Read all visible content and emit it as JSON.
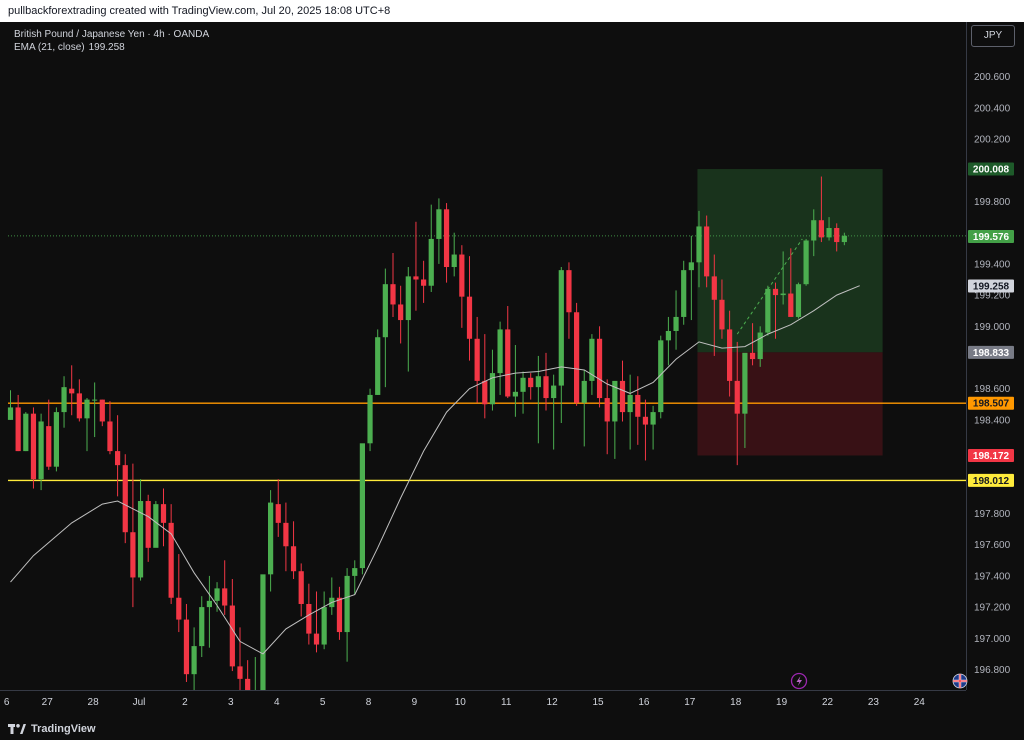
{
  "header": {
    "credit": "pullbackforextrading created with TradingView.com, Jul 20, 2025 18:08 UTC+8"
  },
  "legend": {
    "symbol_line": "British Pound / Japanese Yen · 4h · OANDA",
    "ema_label": "EMA (21, close)",
    "ema_value": "199.258"
  },
  "currency_button": "JPY",
  "footer": {
    "brand": "TradingView"
  },
  "colors": {
    "up": "#4caf50",
    "down": "#f23645",
    "hline_orange": "#ff9800",
    "hline_yellow": "#ffeb3b",
    "ema": "#c0c0c0",
    "profit_zone": "#1b3a1e",
    "loss_zone": "#3d1216"
  },
  "price_axis": {
    "ticks": [
      "200.600",
      "200.400",
      "200.200",
      "199.800",
      "199.400",
      "199.200",
      "199.000",
      "198.600",
      "198.400",
      "197.800",
      "197.600",
      "197.400",
      "197.200",
      "197.000",
      "196.800"
    ],
    "labels": [
      {
        "text": "200.008",
        "price": 200.008,
        "bg": "#1e5b2a",
        "fg": "#ffffff"
      },
      {
        "text": "199.576",
        "price": 199.576,
        "bg": "#43a047",
        "fg": "#ffffff"
      },
      {
        "text": "199.258",
        "price": 199.258,
        "bg": "#d1d4dc",
        "fg": "#131722"
      },
      {
        "text": "198.833",
        "price": 198.833,
        "bg": "#787b86",
        "fg": "#ffffff"
      },
      {
        "text": "198.507",
        "price": 198.507,
        "bg": "#ff9800",
        "fg": "#131722"
      },
      {
        "text": "198.172",
        "price": 198.172,
        "bg": "#f23645",
        "fg": "#ffffff"
      },
      {
        "text": "198.012",
        "price": 198.012,
        "bg": "#ffeb3b",
        "fg": "#131722"
      }
    ]
  },
  "time_axis": [
    {
      "label": "6",
      "bar": -0.5
    },
    {
      "label": "27",
      "bar": 4.8
    },
    {
      "label": "28",
      "bar": 10.8
    },
    {
      "label": "Jul",
      "bar": 16.8
    },
    {
      "label": "2",
      "bar": 22.8
    },
    {
      "label": "3",
      "bar": 28.8
    },
    {
      "label": "4",
      "bar": 34.8
    },
    {
      "label": "5",
      "bar": 40.8
    },
    {
      "label": "8",
      "bar": 46.8
    },
    {
      "label": "9",
      "bar": 52.8
    },
    {
      "label": "10",
      "bar": 58.8
    },
    {
      "label": "11",
      "bar": 64.8
    },
    {
      "label": "12",
      "bar": 70.8
    },
    {
      "label": "15",
      "bar": 76.8
    },
    {
      "label": "16",
      "bar": 82.8
    },
    {
      "label": "17",
      "bar": 88.8
    },
    {
      "label": "18",
      "bar": 94.8
    },
    {
      "label": "19",
      "bar": 100.8
    },
    {
      "label": "22",
      "bar": 106.8
    },
    {
      "label": "23",
      "bar": 112.8
    },
    {
      "label": "24",
      "bar": 118.8
    }
  ],
  "chart_data": {
    "type": "candlestick",
    "symbol": "GBPJPY",
    "timeframe": "4h",
    "y_range": [
      196.72,
      200.72
    ],
    "horizontal_lines": [
      198.507,
      198.012
    ],
    "position": {
      "entry": 198.833,
      "target": 200.008,
      "stop": 198.172,
      "start_bar": 89.8,
      "end_bar": 114.0
    },
    "ohlc": [
      [
        198.4,
        198.59,
        198.4,
        198.48
      ],
      [
        198.48,
        198.56,
        198.2,
        198.2
      ],
      [
        198.2,
        198.45,
        198.2,
        198.44
      ],
      [
        198.44,
        198.48,
        197.96,
        198.02
      ],
      [
        198.02,
        198.44,
        197.95,
        198.39
      ],
      [
        198.36,
        198.53,
        198.08,
        198.1
      ],
      [
        198.1,
        198.48,
        198.07,
        198.45
      ],
      [
        198.45,
        198.68,
        198.35,
        198.61
      ],
      [
        198.6,
        198.75,
        198.43,
        198.57
      ],
      [
        198.57,
        198.66,
        198.39,
        198.41
      ],
      [
        198.41,
        198.54,
        198.2,
        198.53
      ],
      [
        198.53,
        198.64,
        198.29,
        198.53
      ],
      [
        198.53,
        198.53,
        198.36,
        198.39
      ],
      [
        198.39,
        198.52,
        198.18,
        198.2
      ],
      [
        198.2,
        198.43,
        197.91,
        198.11
      ],
      [
        198.11,
        198.18,
        197.61,
        197.68
      ],
      [
        197.68,
        198.12,
        197.2,
        197.39
      ],
      [
        197.39,
        198.02,
        197.37,
        197.88
      ],
      [
        197.88,
        197.92,
        197.49,
        197.58
      ],
      [
        197.58,
        197.88,
        197.61,
        197.86
      ],
      [
        197.86,
        197.96,
        197.59,
        197.74
      ],
      [
        197.74,
        197.86,
        197.22,
        197.26
      ],
      [
        197.26,
        197.54,
        197.04,
        197.12
      ],
      [
        197.12,
        197.22,
        196.72,
        196.77
      ],
      [
        196.77,
        197.07,
        196.56,
        196.95
      ],
      [
        196.95,
        197.27,
        196.88,
        197.2
      ],
      [
        197.2,
        197.4,
        196.94,
        197.24
      ],
      [
        197.24,
        197.36,
        197.17,
        197.32
      ],
      [
        197.32,
        197.5,
        197.15,
        197.21
      ],
      [
        197.21,
        197.38,
        196.79,
        196.82
      ],
      [
        196.82,
        197.07,
        196.63,
        196.74
      ],
      [
        196.74,
        196.86,
        196.52,
        196.55
      ],
      [
        196.55,
        196.88,
        196.45,
        196.6
      ],
      [
        196.6,
        197.18,
        196.58,
        197.41
      ],
      [
        197.41,
        197.95,
        197.3,
        197.87
      ],
      [
        197.86,
        198.02,
        197.65,
        197.74
      ],
      [
        197.74,
        197.87,
        197.43,
        197.59
      ],
      [
        197.59,
        197.75,
        197.38,
        197.43
      ],
      [
        197.43,
        197.48,
        197.14,
        197.22
      ],
      [
        197.22,
        197.35,
        196.96,
        197.03
      ],
      [
        197.03,
        197.3,
        196.91,
        196.96
      ],
      [
        196.96,
        197.3,
        196.93,
        197.2
      ],
      [
        197.2,
        197.39,
        197.15,
        197.26
      ],
      [
        197.26,
        197.33,
        196.99,
        197.04
      ],
      [
        197.04,
        197.45,
        196.85,
        197.4
      ],
      [
        197.4,
        197.5,
        197.28,
        197.45
      ],
      [
        197.45,
        197.86,
        197.41,
        198.25
      ],
      [
        198.25,
        198.6,
        198.2,
        198.56
      ],
      [
        198.56,
        198.98,
        198.56,
        198.93
      ],
      [
        198.93,
        199.37,
        198.61,
        199.27
      ],
      [
        199.27,
        199.47,
        199.06,
        199.14
      ],
      [
        199.14,
        199.26,
        198.89,
        199.04
      ],
      [
        199.04,
        199.38,
        198.71,
        199.32
      ],
      [
        199.32,
        199.67,
        199.1,
        199.3
      ],
      [
        199.3,
        199.42,
        199.15,
        199.26
      ],
      [
        199.26,
        199.78,
        199.22,
        199.56
      ],
      [
        199.56,
        199.82,
        199.4,
        199.75
      ],
      [
        199.75,
        199.79,
        199.28,
        199.38
      ],
      [
        199.38,
        199.6,
        199.32,
        199.46
      ],
      [
        199.46,
        199.52,
        198.99,
        199.19
      ],
      [
        199.19,
        199.45,
        198.78,
        198.92
      ],
      [
        198.92,
        199.06,
        198.51,
        198.65
      ],
      [
        198.65,
        198.95,
        198.41,
        198.5
      ],
      [
        198.5,
        198.85,
        198.46,
        198.7
      ],
      [
        198.7,
        199.03,
        198.56,
        198.98
      ],
      [
        198.98,
        199.13,
        198.54,
        198.55
      ],
      [
        198.55,
        198.88,
        198.42,
        198.58
      ],
      [
        198.58,
        198.71,
        198.44,
        198.67
      ],
      [
        198.67,
        198.7,
        198.53,
        198.61
      ],
      [
        198.61,
        198.81,
        198.25,
        198.68
      ],
      [
        198.68,
        198.83,
        198.46,
        198.54
      ],
      [
        198.54,
        198.69,
        198.21,
        198.62
      ],
      [
        198.62,
        199.38,
        198.38,
        199.36
      ],
      [
        199.36,
        199.41,
        198.92,
        199.09
      ],
      [
        199.09,
        199.15,
        198.49,
        198.51
      ],
      [
        198.51,
        198.72,
        198.23,
        198.65
      ],
      [
        198.65,
        198.95,
        198.56,
        198.92
      ],
      [
        198.92,
        199.0,
        198.48,
        198.54
      ],
      [
        198.54,
        198.66,
        198.18,
        198.39
      ],
      [
        198.39,
        198.59,
        198.15,
        198.65
      ],
      [
        198.65,
        198.78,
        198.39,
        198.45
      ],
      [
        198.45,
        198.69,
        198.21,
        198.56
      ],
      [
        198.56,
        198.68,
        198.24,
        198.42
      ],
      [
        198.42,
        198.53,
        198.14,
        198.37
      ],
      [
        198.37,
        198.49,
        198.21,
        198.45
      ],
      [
        198.45,
        198.94,
        198.41,
        198.91
      ],
      [
        198.91,
        199.06,
        198.75,
        198.97
      ],
      [
        198.97,
        199.23,
        198.85,
        199.06
      ],
      [
        199.06,
        199.42,
        199.01,
        199.36
      ],
      [
        199.36,
        199.58,
        199.04,
        199.41
      ],
      [
        199.41,
        199.74,
        199.25,
        199.64
      ],
      [
        199.64,
        199.71,
        199.25,
        199.32
      ],
      [
        199.32,
        199.46,
        198.81,
        199.17
      ],
      [
        199.17,
        199.3,
        198.92,
        198.98
      ],
      [
        198.98,
        199.1,
        198.55,
        198.65
      ],
      [
        198.65,
        198.9,
        198.11,
        198.44
      ],
      [
        198.44,
        198.79,
        198.22,
        198.83
      ],
      [
        198.83,
        199.02,
        198.75,
        198.79
      ],
      [
        198.79,
        199.0,
        198.74,
        198.96
      ],
      [
        198.96,
        199.26,
        198.94,
        199.24
      ],
      [
        199.24,
        199.28,
        198.92,
        199.2
      ],
      [
        199.2,
        199.48,
        199.14,
        199.21
      ],
      [
        199.21,
        199.5,
        199.08,
        199.06
      ],
      [
        199.06,
        199.28,
        199.05,
        199.27
      ],
      [
        199.27,
        199.56,
        199.26,
        199.55
      ],
      [
        199.55,
        199.75,
        199.45,
        199.68
      ],
      [
        199.68,
        199.96,
        199.54,
        199.57
      ],
      [
        199.57,
        199.7,
        199.55,
        199.63
      ],
      [
        199.63,
        199.66,
        199.48,
        199.54
      ],
      [
        199.54,
        199.6,
        199.52,
        199.58
      ]
    ],
    "ema_21": [
      [
        0,
        197.36
      ],
      [
        3,
        197.53
      ],
      [
        8,
        197.74
      ],
      [
        12,
        197.86
      ],
      [
        14,
        197.88
      ],
      [
        16,
        197.83
      ],
      [
        18,
        197.78
      ],
      [
        21,
        197.67
      ],
      [
        24,
        197.42
      ],
      [
        27,
        197.21
      ],
      [
        30,
        196.98
      ],
      [
        33,
        196.9
      ],
      [
        36,
        197.06
      ],
      [
        39,
        197.15
      ],
      [
        42,
        197.23
      ],
      [
        45,
        197.28
      ],
      [
        48,
        197.58
      ],
      [
        51,
        197.9
      ],
      [
        54,
        198.2
      ],
      [
        57,
        198.45
      ],
      [
        60,
        198.6
      ],
      [
        63,
        198.67
      ],
      [
        66,
        198.7
      ],
      [
        69,
        198.71
      ],
      [
        72,
        198.74
      ],
      [
        75,
        198.72
      ],
      [
        78,
        198.63
      ],
      [
        81,
        198.57
      ],
      [
        84,
        198.64
      ],
      [
        87,
        198.79
      ],
      [
        90,
        198.9
      ],
      [
        93,
        198.86
      ],
      [
        96,
        198.87
      ],
      [
        99,
        198.95
      ],
      [
        102,
        199.01
      ],
      [
        105,
        199.1
      ],
      [
        108,
        199.2
      ],
      [
        111,
        199.26
      ]
    ]
  }
}
